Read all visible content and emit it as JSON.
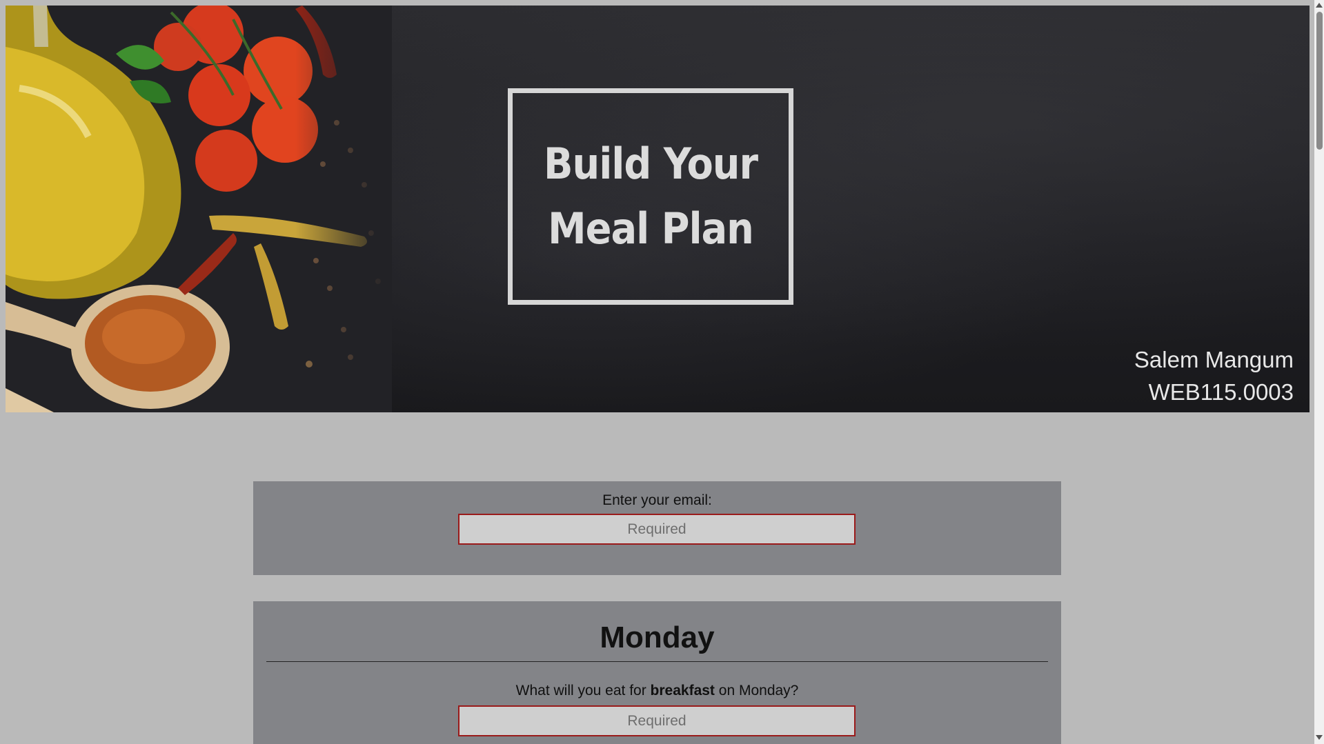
{
  "hero": {
    "title_line1": "Build Your",
    "title_line2": "Meal Plan",
    "author_name": "Salem Mangum",
    "course_code": "WEB115.0003"
  },
  "email": {
    "label": "Enter your email:",
    "placeholder": "Required"
  },
  "monday": {
    "heading": "Monday",
    "breakfast_prefix": "What will you eat for ",
    "breakfast_meal": "breakfast",
    "breakfast_suffix": " on Monday?",
    "breakfast_placeholder": "Required"
  },
  "colors": {
    "page_bg": "#bababa",
    "card_bg": "#838488",
    "input_border": "#9a1a1a",
    "title_border": "#d6d6d6"
  }
}
